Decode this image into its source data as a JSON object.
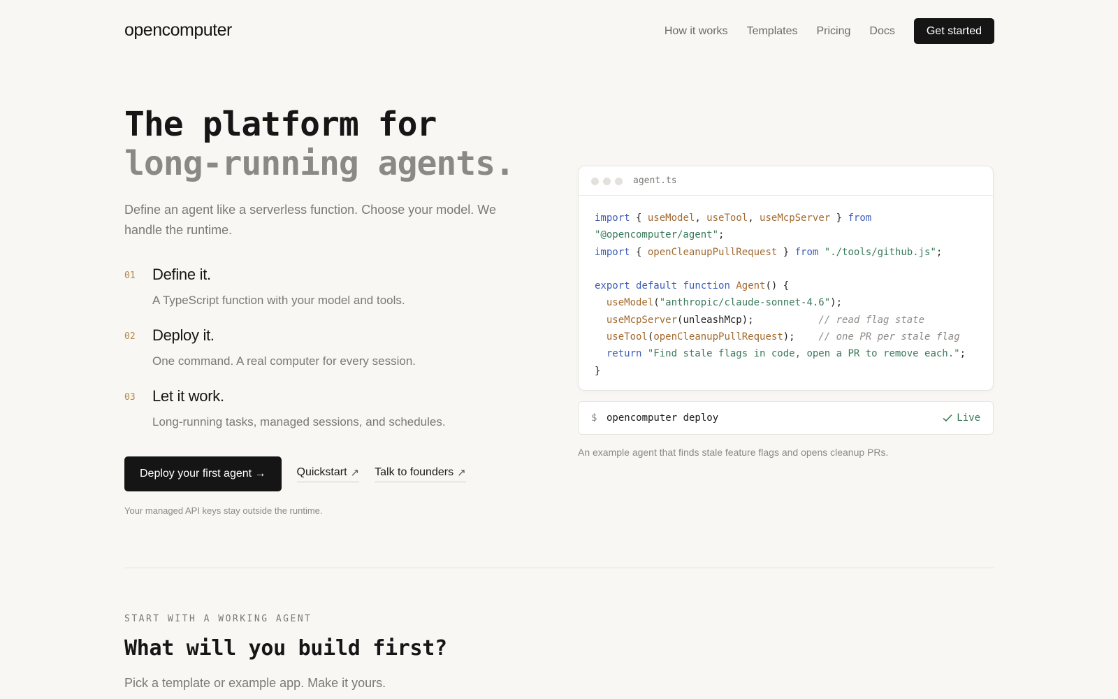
{
  "nav": {
    "logo": "opencomputer",
    "links": [
      "How it works",
      "Templates",
      "Pricing",
      "Docs"
    ],
    "cta": "Get started"
  },
  "hero": {
    "title_line1": "The platform for",
    "title_line2": "long-running agents.",
    "subtitle": "Define an agent like a serverless function. Choose your model. We handle the runtime.",
    "steps": [
      {
        "num": "01",
        "title": "Define it.",
        "desc": "A TypeScript function with your model and tools."
      },
      {
        "num": "02",
        "title": "Deploy it.",
        "desc": "One command. A real computer for every session."
      },
      {
        "num": "03",
        "title": "Let it work.",
        "desc": "Long-running tasks, managed sessions, and schedules."
      }
    ],
    "cta_primary": "Deploy your first agent →",
    "cta_quickstart": "Quickstart",
    "cta_founders": "Talk to founders",
    "link_arrow": "↗",
    "fine_print": "Your managed API keys stay outside the runtime."
  },
  "code": {
    "filename": "agent.ts",
    "lines": [
      [
        {
          "t": "import",
          "c": "kw"
        },
        {
          "t": " { ",
          "c": ""
        },
        {
          "t": "useModel",
          "c": "fn"
        },
        {
          "t": ", ",
          "c": ""
        },
        {
          "t": "useTool",
          "c": "fn"
        },
        {
          "t": ", ",
          "c": ""
        },
        {
          "t": "useMcpServer",
          "c": "fn"
        },
        {
          "t": " } ",
          "c": ""
        },
        {
          "t": "from",
          "c": "kw"
        }
      ],
      [
        {
          "t": "\"@opencomputer/agent\"",
          "c": "str"
        },
        {
          "t": ";",
          "c": ""
        }
      ],
      [
        {
          "t": "import",
          "c": "kw"
        },
        {
          "t": " { ",
          "c": ""
        },
        {
          "t": "openCleanupPullRequest",
          "c": "fn"
        },
        {
          "t": " } ",
          "c": ""
        },
        {
          "t": "from",
          "c": "kw"
        },
        {
          "t": " ",
          "c": ""
        },
        {
          "t": "\"./tools/github.js\"",
          "c": "str"
        },
        {
          "t": ";",
          "c": ""
        }
      ],
      [],
      [
        {
          "t": "export",
          "c": "kw"
        },
        {
          "t": " ",
          "c": ""
        },
        {
          "t": "default",
          "c": "kw"
        },
        {
          "t": " ",
          "c": ""
        },
        {
          "t": "function",
          "c": "kw"
        },
        {
          "t": " ",
          "c": ""
        },
        {
          "t": "Agent",
          "c": "fn"
        },
        {
          "t": "() {",
          "c": ""
        }
      ],
      [
        {
          "t": "  ",
          "c": ""
        },
        {
          "t": "useModel",
          "c": "fn"
        },
        {
          "t": "(",
          "c": ""
        },
        {
          "t": "\"anthropic/claude-sonnet-4.6\"",
          "c": "str"
        },
        {
          "t": ");",
          "c": ""
        }
      ],
      [
        {
          "t": "  ",
          "c": ""
        },
        {
          "t": "useMcpServer",
          "c": "fn"
        },
        {
          "t": "(unleashMcp);           ",
          "c": ""
        },
        {
          "t": "// read flag state",
          "c": "cm"
        }
      ],
      [
        {
          "t": "  ",
          "c": ""
        },
        {
          "t": "useTool",
          "c": "fn"
        },
        {
          "t": "(",
          "c": ""
        },
        {
          "t": "openCleanupPullRequest",
          "c": "fn"
        },
        {
          "t": ");    ",
          "c": ""
        },
        {
          "t": "// one PR per stale flag",
          "c": "cm"
        }
      ],
      [
        {
          "t": "  ",
          "c": ""
        },
        {
          "t": "return",
          "c": "kw"
        },
        {
          "t": " ",
          "c": ""
        },
        {
          "t": "\"Find stale flags in code, open a PR to remove each.\"",
          "c": "str"
        },
        {
          "t": ";",
          "c": ""
        }
      ],
      [
        {
          "t": "}",
          "c": ""
        }
      ]
    ],
    "deploy_prompt": "$",
    "deploy_command": "opencomputer deploy",
    "deploy_status": "Live",
    "caption": "An example agent that finds stale feature flags and opens cleanup PRs."
  },
  "templates": {
    "eyebrow": "START WITH A WORKING AGENT",
    "title": "What will you build first?",
    "subtitle": "Pick a template or example app. Make it yours."
  },
  "colors": {
    "background": "#f8f7f4",
    "primary_button": "#151515",
    "step_number": "#b08a4a",
    "code_keyword": "#3d5db8",
    "code_function": "#a26a2f",
    "code_string": "#3a7a5a",
    "status_live": "#3a7a5a"
  },
  "icons": [
    "external-arrow-icon",
    "check-icon",
    "window-dot-icon"
  ]
}
